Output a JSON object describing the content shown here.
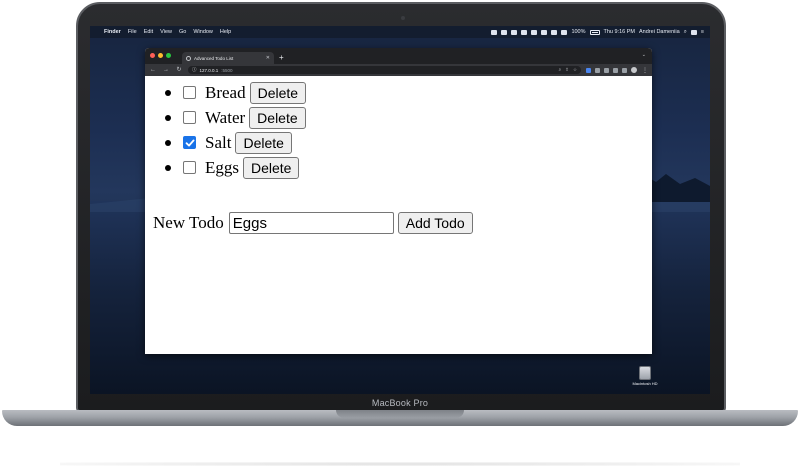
{
  "laptop": {
    "brand": "MacBook Pro"
  },
  "menubar": {
    "app_name": "Finder",
    "menus": [
      "File",
      "Edit",
      "View",
      "Go",
      "Window",
      "Help"
    ],
    "battery": "100%",
    "clock": "Thu 9:16 PM",
    "user": "Andrei Dameniia"
  },
  "desktop": {
    "drive_label": "Macintosh HD"
  },
  "browser": {
    "tab_title": "Advanced Todo List",
    "new_tab": "+",
    "url_host": "127.0.0.1",
    "url_port": ":5500"
  },
  "todos": [
    {
      "label": "Bread",
      "checked": false,
      "delete_label": "Delete"
    },
    {
      "label": "Water",
      "checked": false,
      "delete_label": "Delete"
    },
    {
      "label": "Salt",
      "checked": true,
      "delete_label": "Delete"
    },
    {
      "label": "Eggs",
      "checked": false,
      "delete_label": "Delete"
    }
  ],
  "new_todo": {
    "label": "New Todo",
    "input_value": "Eggs",
    "add_label": "Add Todo"
  },
  "colors": {
    "checkbox_checked": "#1a73e8",
    "chrome_dark": "#202124"
  }
}
